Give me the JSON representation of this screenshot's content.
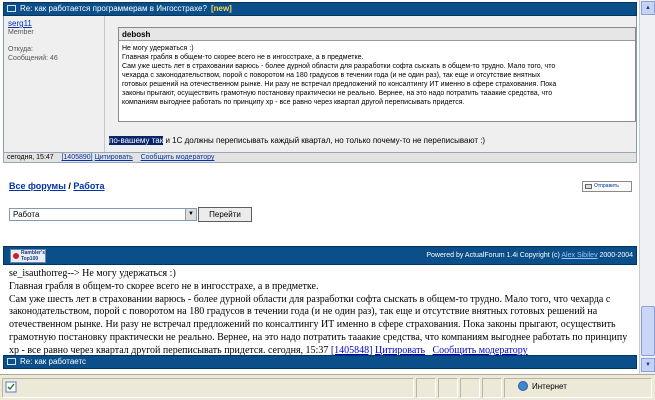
{
  "thread": {
    "title": "Re: как работается программерам в Ингосстрахе?",
    "new_badge": "[new]"
  },
  "author": {
    "name": "serg11",
    "role": "Member",
    "from_label": "Откуда:",
    "messages_label": "Сообщений: 46"
  },
  "quote": {
    "author": "debosh",
    "lines": [
      "Не могу удержаться :)",
      "Главная грабля в общем-то скорее всего не в ингосстрахе, а в предметке.",
      "Сам уже шесть лет в страховании варюсь - более дурной области для разработки софта сыскать в общем-то трудно. Мало того, что",
      "чехарда с законодательством, порой с поворотом на 180 градусов в течении года (и не один раз), так еще и отсутствие внятных",
      "готовых решений на отечественном рынке. Ни разу не встречал предложений по консалтингу ИТ именно в сфере страхования. Пока",
      "законы прыгают, осуществить грамотную постановку практически не реально. Вернее, на это надо потратить тааакие средства, что",
      "компаниям выгоднее работать по принципу хр - все равно через квартал другой переписывать придется."
    ]
  },
  "reply": {
    "highlighted": "по-вашему так",
    "rest": " и 1С должны переписывать каждый квартал, но только почему-то не переписывают :)"
  },
  "post_footer": {
    "time": "сегодня, 15:47",
    "id": "[1405890]",
    "quote_link": "Цитировать",
    "report_link": "Сообщить модератору"
  },
  "breadcrumb": {
    "all_forums": "Все форумы",
    "sep": " / ",
    "current": "Работа"
  },
  "print_label": "Отправить",
  "forum_select": {
    "value": "Работа",
    "go_label": "Перейти"
  },
  "powered": {
    "rambler": "Rambler's",
    "rambler2": "Top100",
    "text_pre": "Powered by ActualForum 1.4i Copyright (c) ",
    "author_link": "Alex Sibilev",
    "text_post": " 2000-2004"
  },
  "raw": {
    "line1": "se_isauthorreg--> Не могу удержаться :)",
    "line2": "Главная грабля в общем-то скорее всего не в ингосстрахе, а в предметке.",
    "paragraph": "Сам уже шесть лет в страховании варюсь - более дурной области для разработки софта сыскать в общем-то трудно. Мало того, что чехарда с законодательством, порой с поворотом на 180 градусов в течении года (и не один раз), так еще и отсутствие внятных готовых решений на отечественном рынке. Ни разу не встречал предложений по консалтингу ИТ именно в сфере страхования. Пока законы прыгают, осуществить грамотную постановку практически не реально. Вернее, на это надо потратить тааакие средства, что компаниям выгоднее работать по принципу хр - все равно через квартал другой переписывать придется. сегодня, 15:37 ",
    "id": "[1405848]",
    "quote_link": "Цитировать",
    "report_link": "Сообщить модератору"
  },
  "bottom_bar": {
    "title": "Re: как работаетс"
  },
  "status": {
    "zone": "Интернет"
  },
  "colors": {
    "title_bar": "#0a4f8a",
    "post_bg": "#efefef",
    "link": "#0033aa",
    "status_bar": "#ece9d8"
  }
}
